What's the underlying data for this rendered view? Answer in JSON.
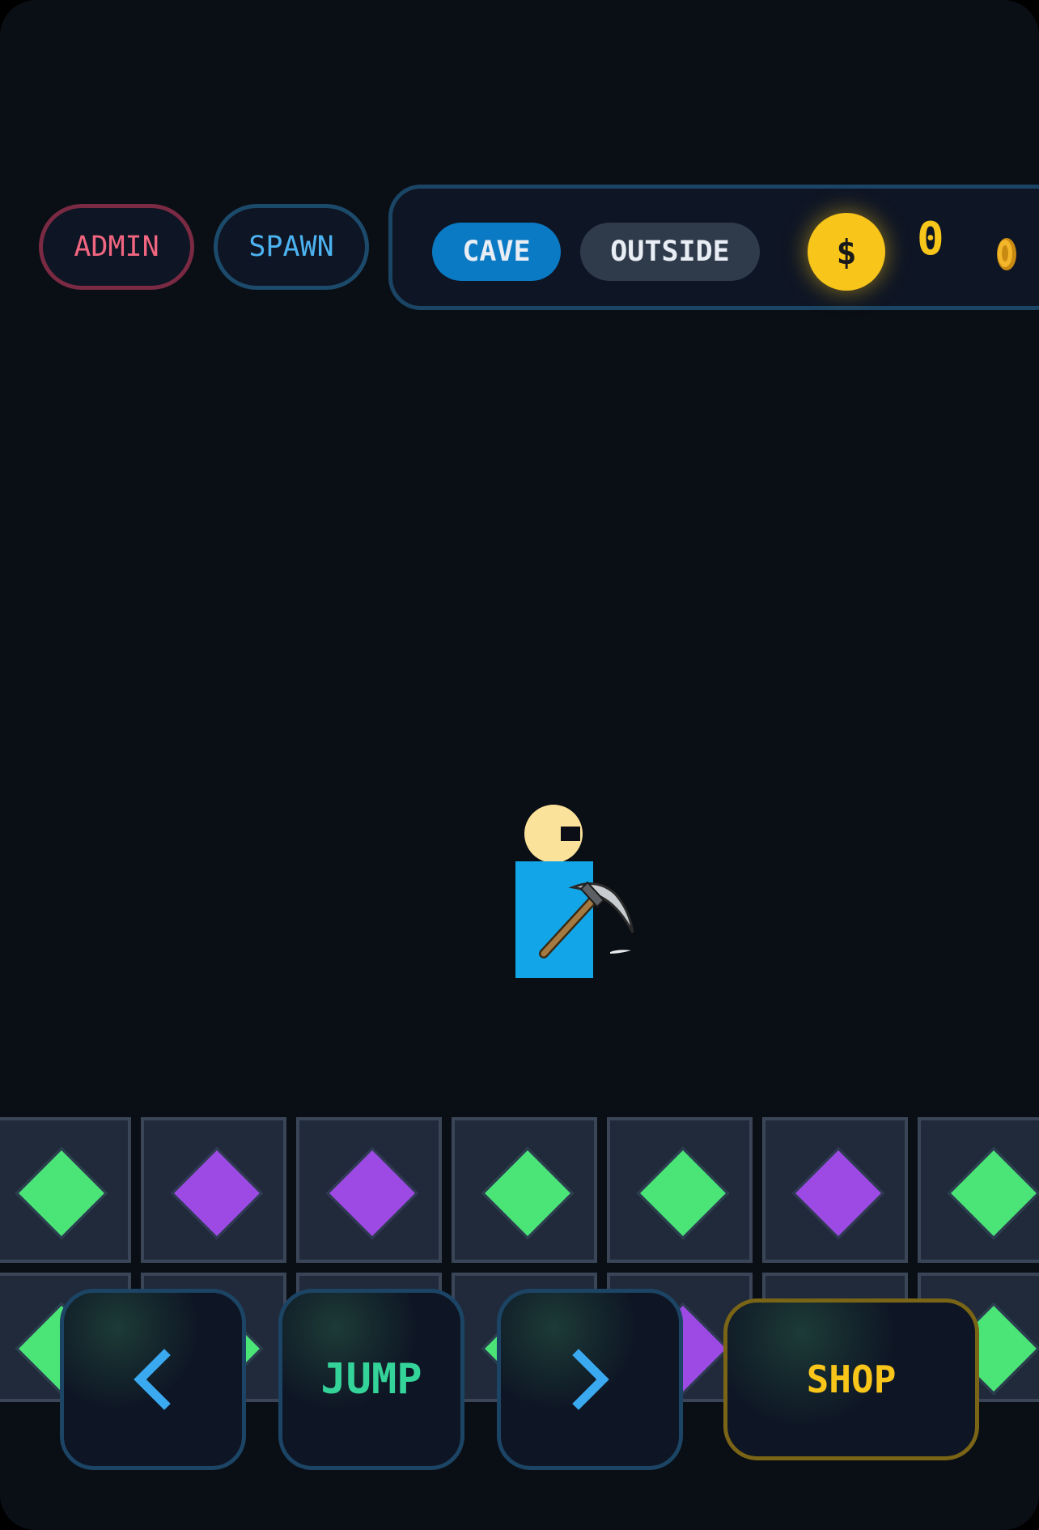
{
  "top_buttons": {
    "admin_label": "ADMIN",
    "spawn_label": "SPAWN"
  },
  "hud": {
    "tabs": [
      {
        "label": "CAVE",
        "active": true
      },
      {
        "label": "OUTSIDE",
        "active": false
      }
    ],
    "currency_symbol": "$",
    "coin_count": "0"
  },
  "tiles_row1": [
    "green",
    "purple",
    "purple",
    "green",
    "green",
    "purple",
    "green"
  ],
  "tiles_row2": [
    "green",
    "green",
    "green",
    "green",
    "purple",
    "purple",
    "green"
  ],
  "controls": {
    "left_icon": "chevron-left-icon",
    "jump_label": "JUMP",
    "right_icon": "chevron-right-icon",
    "shop_label": "SHOP"
  },
  "colors": {
    "gem_green": "#4ae477",
    "gem_purple": "#9d4ae4",
    "coin": "#f8c51a",
    "active_tab": "#0a7ac4"
  }
}
